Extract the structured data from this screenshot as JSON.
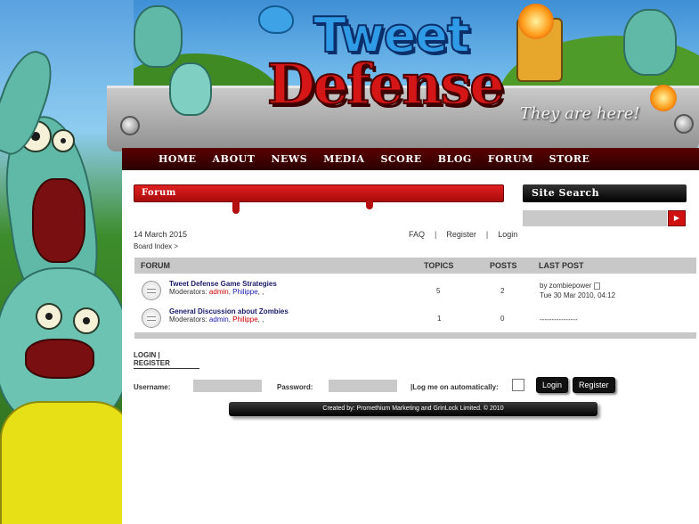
{
  "header": {
    "logo_line1": "Tweet",
    "logo_line2": "Defense",
    "tagline": "They are here!"
  },
  "nav": {
    "items": [
      "Home",
      "About",
      "News",
      "Media",
      "Score",
      "Blog",
      "Forum",
      "Store"
    ]
  },
  "section_title": "Forum",
  "search": {
    "title": "Site Search",
    "value": "",
    "button_icon": "play-arrow-icon"
  },
  "date": "14 March 2015",
  "top_links": [
    "FAQ",
    "Register",
    "Login"
  ],
  "top_links_separator": "|",
  "breadcrumb": "Board Index >",
  "forum_table": {
    "columns": [
      "FORUM",
      "TOPICS",
      "POSTS",
      "LAST POST"
    ],
    "rows": [
      {
        "title": "Tweet Defense Game Strategies",
        "moderators_label": "Moderators:",
        "mod1": "admin",
        "mod2": "Philippe",
        "trail": ",",
        "topics": "5",
        "posts": "2",
        "last_post_by": "by zombiepower",
        "last_post_time": "Tue 30 Mar 2010, 04:12"
      },
      {
        "title": "General Discussion about Zombies",
        "moderators_label": "Moderators:",
        "mod1": "admin",
        "mod2": "Philippe",
        "trail": ",",
        "topics": "1",
        "posts": "0",
        "last_post_by": "----------------",
        "last_post_time": ""
      }
    ]
  },
  "login": {
    "heading_line1": "LOGIN |",
    "heading_line2": "REGISTER",
    "username_label": "Username:",
    "username_value": "",
    "password_label": "Password:",
    "password_value": "",
    "auto_label": "|Log me on automatically:",
    "login_button": "Login",
    "register_button": "Register"
  },
  "footer": "Created by: Promethium Marketing and GrinLock Limited. © 2010",
  "colors": {
    "nav_bg": "#3a0000",
    "banner_red": "#d41616",
    "table_header": "#c8c8c8",
    "moderator_red": "#c80000",
    "moderator_blue": "#1a1ab0"
  }
}
